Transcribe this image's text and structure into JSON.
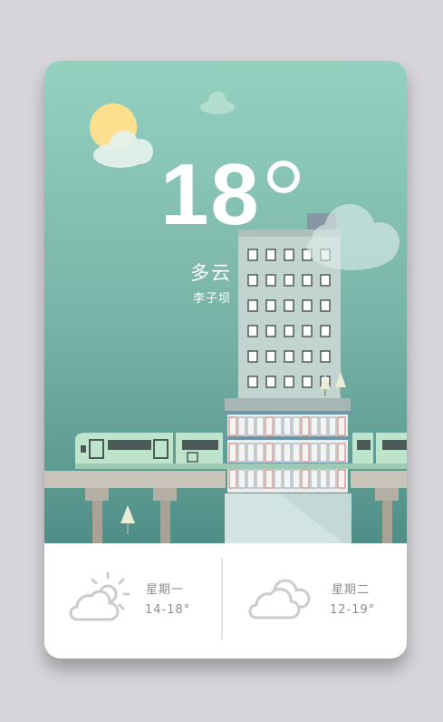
{
  "current": {
    "temperature": "18",
    "condition": "多云",
    "location": "李子坝"
  },
  "forecast": [
    {
      "day": "星期一",
      "range": "14-18°",
      "icon": "partly-sunny-cloud-icon"
    },
    {
      "day": "星期二",
      "range": "12-19°",
      "icon": "cloud-icon"
    }
  ],
  "colors": {
    "sky_top": "#95d1bf",
    "sky_bottom": "#4f8e87",
    "sun": "#fde08e",
    "train": "#bfe4cc",
    "icon_gray": "#cccccc",
    "text_gray": "#8a8f8d"
  }
}
